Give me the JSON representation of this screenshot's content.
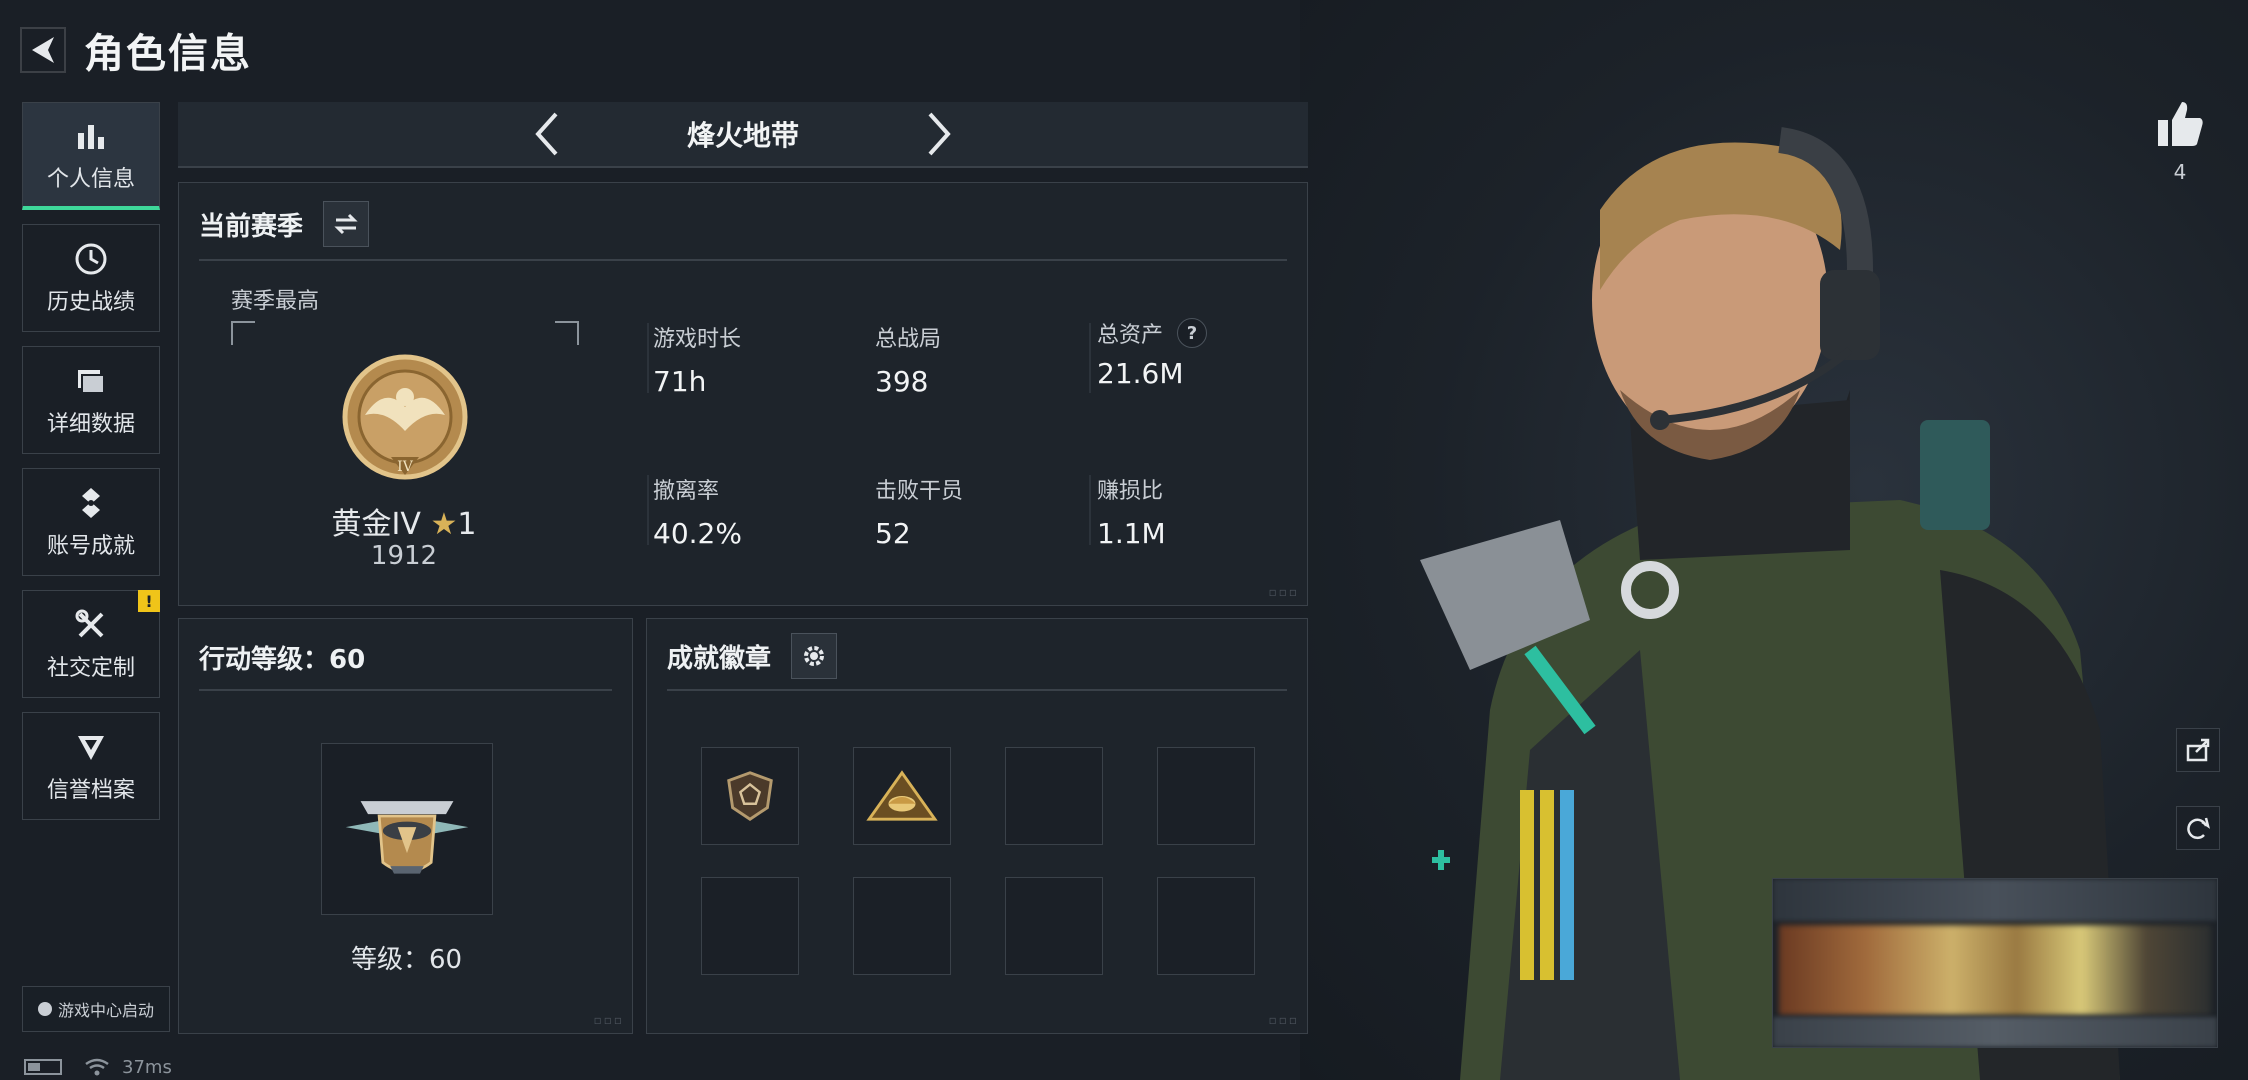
{
  "header": {
    "title": "角色信息"
  },
  "sidebar": {
    "items": [
      {
        "label": "个人信息",
        "icon": "bar-chart-icon",
        "active": true
      },
      {
        "label": "历史战绩",
        "icon": "clock-icon"
      },
      {
        "label": "详细数据",
        "icon": "folder-icon"
      },
      {
        "label": "账号成就",
        "icon": "medal-icon"
      },
      {
        "label": "社交定制",
        "icon": "tools-icon",
        "badge": "!"
      },
      {
        "label": "信誉档案",
        "icon": "shield-icon"
      }
    ],
    "game_center": "游戏中心启动"
  },
  "status": {
    "ping": "37ms"
  },
  "mode": {
    "name": "烽火地带"
  },
  "season_panel": {
    "title": "当前赛季",
    "best_label": "赛季最高",
    "rank_name": "黄金IV",
    "rank_stars": "1",
    "rank_score": "1912",
    "stats": [
      {
        "label": "游戏时长",
        "value": "71h"
      },
      {
        "label": "总战局",
        "value": "398"
      },
      {
        "label": "总资产",
        "value": "21.6M",
        "help": "?"
      },
      {
        "label": "撤离率",
        "value": "40.2%"
      },
      {
        "label": "击败干员",
        "value": "52"
      },
      {
        "label": "赚损比",
        "value": "1.1M"
      }
    ]
  },
  "level_panel": {
    "title": "行动等级：60",
    "level_text": "等级：60"
  },
  "badges_panel": {
    "title": "成就徽章",
    "slots": 8,
    "filled": 2
  },
  "likes": {
    "count": "4"
  },
  "colors": {
    "accent": "#3ed89a",
    "badge": "#f0c419",
    "gold": "#d8b258"
  }
}
